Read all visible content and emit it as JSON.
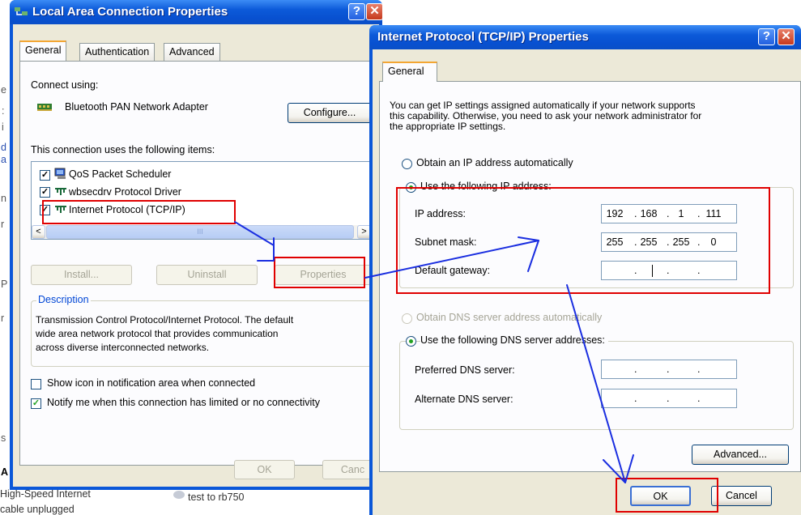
{
  "background": {
    "left_fragments": [
      "e",
      ":",
      "i",
      "d",
      "a",
      "n",
      "r",
      "P",
      "r",
      "s",
      "A"
    ],
    "bottom_items": [
      "High-Speed Internet",
      "cable unplugged",
      "test to rb750"
    ]
  },
  "lac_window": {
    "title": "Local Area Connection Properties",
    "help_label": "?",
    "close_label": "✕",
    "tabs": [
      "General",
      "Authentication",
      "Advanced"
    ],
    "connect_using_label": "Connect using:",
    "adapter_name": "Bluetooth PAN Network Adapter",
    "configure_label": "Configure...",
    "items_label": "This connection uses the following items:",
    "items": [
      {
        "label": "QoS Packet Scheduler",
        "checked": true
      },
      {
        "label": "wbsecdrv Protocol Driver",
        "checked": true
      },
      {
        "label": "Internet Protocol (TCP/IP)",
        "checked": true
      }
    ],
    "scroll_left": "<",
    "scroll_right": ">",
    "scroll_grip": "III",
    "install_label": "Install...",
    "uninstall_label": "Uninstall",
    "properties_label": "Properties",
    "description_legend": "Description",
    "description_text": [
      "Transmission Control Protocol/Internet Protocol. The default",
      "wide area network protocol that provides communication",
      "across diverse interconnected networks."
    ],
    "show_icon_label": "Show icon in notification area when connected",
    "notify_label": "Notify me when this connection has limited or no connectivity",
    "ok_label": "OK",
    "cancel_label": "Canc"
  },
  "tcpip_window": {
    "title": "Internet Protocol (TCP/IP) Properties",
    "help_label": "?",
    "close_label": "✕",
    "tab": "General",
    "intro": [
      "You can get IP settings assigned automatically if your network supports",
      "this capability. Otherwise, you need to ask your network administrator for",
      "the appropriate IP settings."
    ],
    "obtain_ip_label": "Obtain an IP address automatically",
    "use_ip_label": "Use the following IP address:",
    "ip_label": "IP address:",
    "ip_value": [
      "192",
      "168",
      "1",
      "111"
    ],
    "subnet_label": "Subnet mask:",
    "subnet_value": [
      "255",
      "255",
      "255",
      "0"
    ],
    "gateway_label": "Default gateway:",
    "obtain_dns_label": "Obtain DNS server address automatically",
    "use_dns_label": "Use the following DNS server addresses:",
    "preferred_dns_label": "Preferred DNS server:",
    "alternate_dns_label": "Alternate DNS server:",
    "ip_dot": ".",
    "advanced_label": "Advanced...",
    "ok_label": "OK",
    "cancel_label": "Cancel"
  },
  "colors": {
    "annotation_red": "#e00000",
    "annotation_arrow": "#1a2ee0",
    "xp_title_blue": "#0a57d8"
  }
}
